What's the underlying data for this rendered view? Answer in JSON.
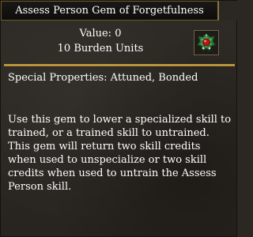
{
  "window": {
    "title": "Assess Person Gem of Forgetfulness"
  },
  "item": {
    "value_text": "Value: 0",
    "burden_text": "10 Burden Units",
    "icon": "forgetfulness-gem-icon",
    "special_properties": "Special Properties: Attuned, Bonded",
    "description_lines": [
      "Use this gem to lower a specialized skill to",
      "trained, or a trained skill to untrained.",
      "This gem will return two skill credits",
      "when used to unspecialize or two skill",
      "credits when used to untrain the Assess",
      "Person skill."
    ]
  },
  "colors": {
    "text": "#ffffff",
    "divider_gold": "#e0b850",
    "panel_bg": "#2b2722",
    "title_bg": "#121110"
  }
}
